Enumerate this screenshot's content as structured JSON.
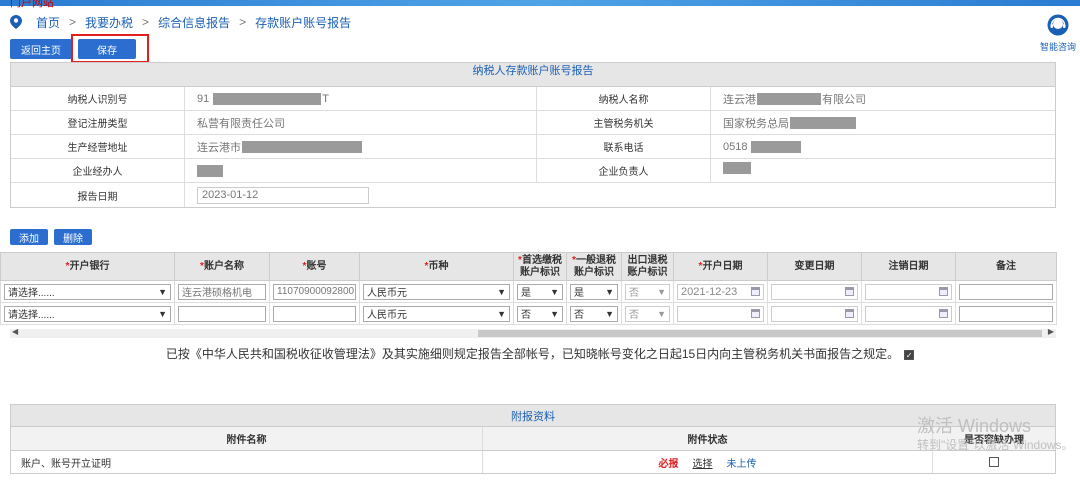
{
  "top": {
    "logo_text": "门户网站"
  },
  "breadcrumb": {
    "home": "首页",
    "l1": "我要办税",
    "l2": "综合信息报告",
    "current": "存款账户账号报告"
  },
  "helper": {
    "label": "智能咨询"
  },
  "toolbar": {
    "back": "返回主页",
    "save": "保存",
    "add": "添加",
    "delete": "删除"
  },
  "info": {
    "title": "纳税人存款账户账号报告",
    "tax_id_label": "纳税人识别号",
    "tax_id_prefix": "91",
    "tax_id_suffix": "T",
    "name_label": "纳税人名称",
    "name_prefix": "连云港",
    "name_suffix": "有限公司",
    "reg_type_label": "登记注册类型",
    "reg_type": "私营有限责任公司",
    "tax_office_label": "主管税务机关",
    "tax_office": "国家税务总局",
    "address_label": "生产经营地址",
    "address": "连云港市",
    "phone_label": "联系电话",
    "phone": "0518",
    "agent_label": "企业经办人",
    "head_label": "企业负责人",
    "date_label": "报告日期",
    "date": "2023-01-12"
  },
  "grid": {
    "headers": {
      "bank": "开户银行",
      "acct_name": "账户名称",
      "acct_no": "账号",
      "currency": "币种",
      "pref_a": "首选缴税",
      "pref_b": "账户标识",
      "refund_a": "一般退税",
      "refund_b": "账户标识",
      "export_a": "出口退税",
      "export_b": "账户标识",
      "open_date": "开户日期",
      "change_date": "变更日期",
      "cancel_date": "注销日期",
      "remark": "备注"
    },
    "rows": [
      {
        "bank": "请选择......",
        "acct_name": "连云港硕格机电",
        "acct_no": "11070900092800",
        "currency": "人民币元",
        "pref": "是",
        "refund": "是",
        "export": "否",
        "open_date": "2021-12-23"
      },
      {
        "bank": "请选择......",
        "acct_name": "",
        "acct_no": "",
        "currency": "人民币元",
        "pref": "否",
        "refund": "否",
        "export": "否",
        "open_date": ""
      }
    ]
  },
  "declaration": "已按《中华人民共和国税收征收管理法》及其实施细则规定报告全部帐号，已知晓帐号变化之日起15日内向主管税务机关书面报告之规定。",
  "attachments": {
    "title": "附报资料",
    "col_name": "附件名称",
    "col_status": "附件状态",
    "col_paper": "是否容缺办理",
    "rows": [
      {
        "name": "账户、账号开立证明",
        "required": "必报",
        "choose": "选择",
        "status": "未上传"
      }
    ]
  },
  "watermark": {
    "line1": "激活 Windows",
    "line2": "转到\"设置\"以激活 Windows。"
  },
  "colors": {
    "primary": "#2b6ecf",
    "link": "#1a5fb4",
    "required": "#e02020",
    "highlight": "#e02020"
  }
}
